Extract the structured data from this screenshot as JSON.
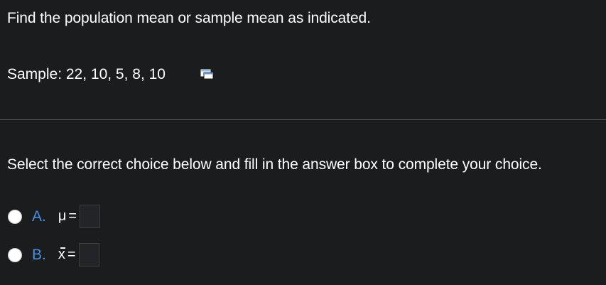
{
  "question": {
    "text": "Find the population mean or sample mean as indicated."
  },
  "sample": {
    "label": "Sample: 22, 10, 5, 8, 10",
    "values": [
      22,
      10,
      5,
      8,
      10
    ],
    "icon": "data-table-icon"
  },
  "instruction": {
    "text": "Select the correct choice below and fill in the answer box to complete your choice."
  },
  "choices": [
    {
      "letter": "A.",
      "symbol": "μ",
      "equals": "=",
      "answer_value": ""
    },
    {
      "letter": "B.",
      "symbol": "x",
      "equals": "=",
      "answer_value": ""
    }
  ],
  "colors": {
    "background": "#1b1c1e",
    "text": "#ffffff",
    "choice_letter": "#4a90e2",
    "divider": "#5a5b5e"
  }
}
